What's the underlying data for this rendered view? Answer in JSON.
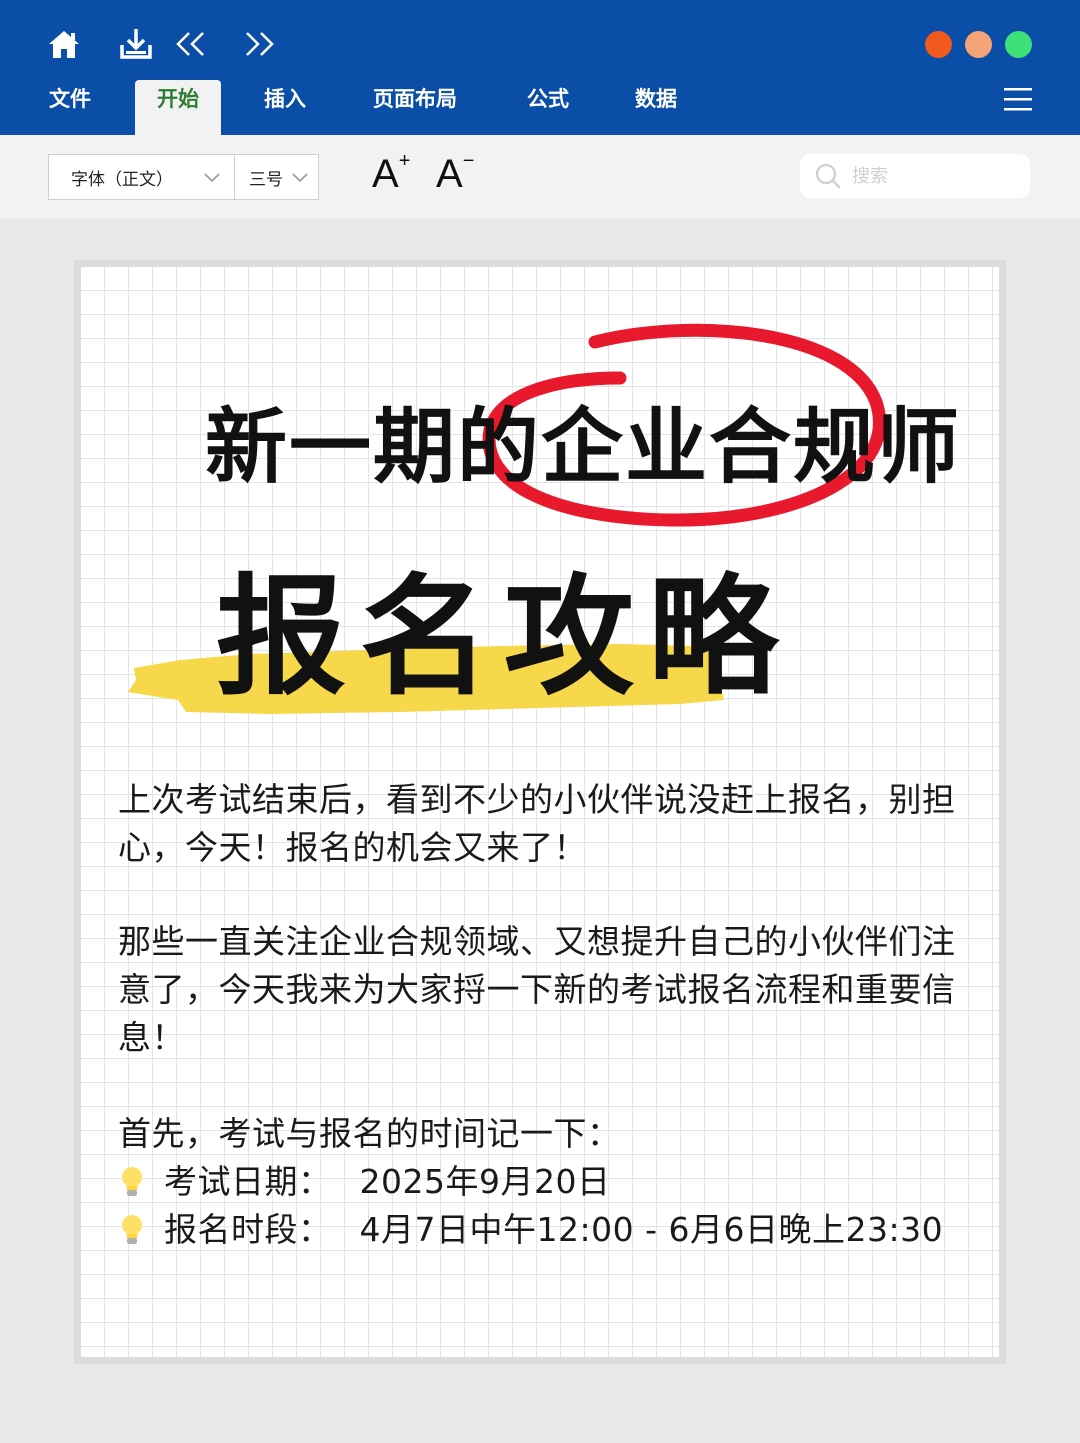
{
  "toolbar_top": {
    "icons": [
      "home-icon",
      "download-icon",
      "undo-icon",
      "redo-icon"
    ],
    "window_dots": [
      "#f05a1e",
      "#f5a377",
      "#3ee07a"
    ],
    "tabs": [
      {
        "label": "文件"
      },
      {
        "label": "开始",
        "active": true
      },
      {
        "label": "插入"
      },
      {
        "label": "页面布局"
      },
      {
        "label": "公式"
      },
      {
        "label": "数据"
      }
    ]
  },
  "format_bar": {
    "font": "字体（正文）",
    "size": "三号",
    "grow_label": "A",
    "shrink_label": "A",
    "search_placeholder": "搜索"
  },
  "document": {
    "headline_prefix": "新一期的",
    "headline_circled": "企业合规师",
    "headline_main": "报名攻略",
    "para1": "上次考试结束后，看到不少的小伙伴说没赶上报名，别担心，今天！报名的机会又来了！",
    "para2": "那些一直关注企业合规领域、又想提升自己的小伙伴们注意了，今天我来为大家捋一下新的考试报名流程和重要信息！",
    "intro": "首先，考试与报名的时间记一下：",
    "items": [
      {
        "label": "考试日期：",
        "value": "2025年9月20日"
      },
      {
        "label": "报名时段：",
        "value": "4月7日中午12:00 - 6月6日晚上23:30"
      }
    ]
  },
  "colors": {
    "ribbon": "#0a4ea8",
    "active_tab_text": "#2e7d32",
    "circle": "#e8192c",
    "highlight": "#f7d84a"
  }
}
